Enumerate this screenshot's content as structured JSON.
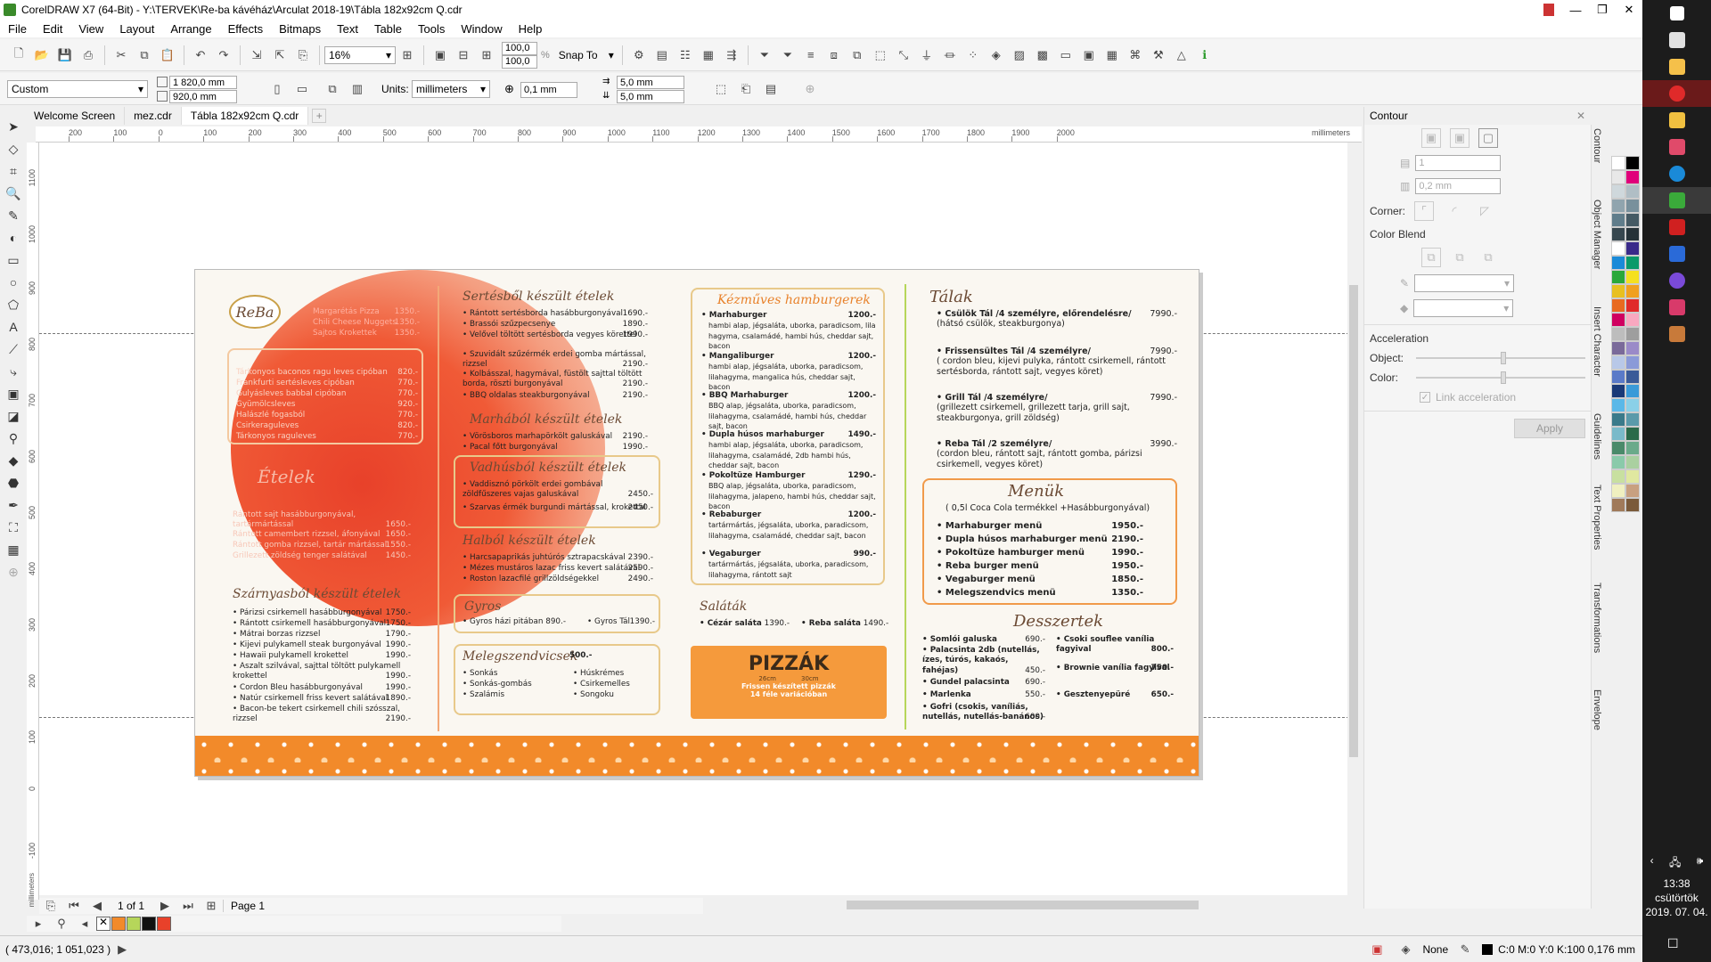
{
  "window": {
    "title": "CorelDRAW X7 (64-Bit) - Y:\\TERVEK\\Re-ba kávéház\\Arculat 2018-19\\Tábla 182x92cm Q.cdr"
  },
  "menu": [
    "File",
    "Edit",
    "View",
    "Layout",
    "Arrange",
    "Effects",
    "Bitmaps",
    "Text",
    "Table",
    "Tools",
    "Window",
    "Help"
  ],
  "toolbar": {
    "zoom": "16%",
    "snap_to": "Snap To",
    "scale_x": "100,0",
    "scale_y": "100,0",
    "pct": "%"
  },
  "propbar": {
    "preset": "Custom",
    "width": "1 820,0 mm",
    "height": "920,0 mm",
    "units_label": "Units:",
    "units": "millimeters",
    "nudge": "0,1 mm",
    "dup_x": "5,0 mm",
    "dup_y": "5,0 mm"
  },
  "tabs": [
    "Welcome Screen",
    "mez.cdr",
    "Tábla 182x92cm Q.cdr"
  ],
  "ruler": {
    "unit": "millimeters",
    "h_ticks": [
      "200",
      "100",
      "0",
      "100",
      "200",
      "300",
      "400",
      "500",
      "600",
      "700",
      "800",
      "900",
      "1000",
      "1100",
      "1200",
      "1300",
      "1400",
      "1500",
      "1600",
      "1700",
      "1800",
      "1900",
      "2000"
    ],
    "v_ticks": [
      "1100",
      "1000",
      "900",
      "800",
      "700",
      "600",
      "500",
      "400",
      "300",
      "200",
      "100",
      "0",
      "-100"
    ],
    "v_unit": "millimeters"
  },
  "pagenav": {
    "page_of": "1 of 1",
    "page_tab": "Page 1"
  },
  "status": {
    "coords": "( 473,016; 1 051,023 )",
    "fill": "None",
    "outline": "C:0 M:0 Y:0 K:100  0,176 mm"
  },
  "docker": {
    "title": "Contour",
    "steps": "1",
    "offset": "0,2 mm",
    "corner_label": "Corner:",
    "color_blend": "Color Blend",
    "acceleration": "Acceleration",
    "object_label": "Object:",
    "color_label": "Color:",
    "link_accel": "Link acceleration",
    "apply": "Apply"
  },
  "docker_tabs": [
    "Contour",
    "Object Manager",
    "Insert Character",
    "Guidelines",
    "Text Properties",
    "Transformations",
    "Envelope"
  ],
  "taskbar": {
    "time": "13:38",
    "day": "csütörtök",
    "date": "2019. 07. 04."
  },
  "colors": {
    "accent": "#e8412a",
    "orange": "#f28a2a",
    "gold": "#e8c98a"
  },
  "menu_doc": {
    "logo": "ReBa",
    "col1_top": [
      {
        "t": "Margarétás Pizza",
        "p": "1350.-"
      },
      {
        "t": "Chili Cheese Nuggets",
        "p": "1350.-"
      },
      {
        "t": "Sajtos Krokettek",
        "p": "1350.-"
      }
    ],
    "col1_box": [
      {
        "t": "Tárkonyos baconos ragu leves cipóban",
        "p": "820.-"
      },
      {
        "t": "Frankfurti sertésleves cipóban",
        "p": "770.-"
      },
      {
        "t": "Gulyásleves babbal cipóban",
        "p": "770.-"
      },
      {
        "t": "Gyümölcsleves",
        "p": "920.-"
      },
      {
        "t": "Halászlé fogasból",
        "p": "770.-"
      },
      {
        "t": "Csirkeraguleves",
        "p": "820.-"
      },
      {
        "t": "Tárkonyos raguleves",
        "p": "770.-"
      }
    ],
    "col1_mid_title": "Ételek",
    "col1_mid": [
      {
        "t": "Rántott sajt hasábburgonyával, tartármártással",
        "p": "1650.-"
      },
      {
        "t": "Rántott camembert rizzsel, áfonyával",
        "p": "1650.-"
      },
      {
        "t": "Rántott gomba rizzsel, tartár mártással",
        "p": "1550.-"
      },
      {
        "t": "Grillezett zöldség tenger salátával",
        "p": "1450.-"
      }
    ],
    "col1_bot_title": "Szárnyasból készült ételek",
    "col1_bot": [
      {
        "t": "Párizsi csirkemell hasábburgonyával",
        "p": "1750.-"
      },
      {
        "t": "Rántott csirkemell hasábburgonyával",
        "p": "1750.-"
      },
      {
        "t": "Mátrai borzas rizzsel",
        "p": "1790.-"
      },
      {
        "t": "Kijevi pulykamell steak burgonyával",
        "p": "1990.-"
      },
      {
        "t": "Hawaii pulykamell krokettel",
        "p": "1990.-"
      },
      {
        "t": "Aszalt szilvával, sajttal töltött pulykamell krokettel",
        "p": "1990.-"
      },
      {
        "t": "Cordon Bleu hasábburgonyával",
        "p": "1990.-"
      },
      {
        "t": "Natúr csirkemell friss kevert salátával",
        "p": "1890.-"
      },
      {
        "t": "Bacon-be tekert csirkemell chili szósszal, rizzsel",
        "p": "2190.-"
      }
    ],
    "col2_title": "Sertésből készült ételek",
    "col2": [
      {
        "t": "Rántott sertésborda hasábburgonyával",
        "p": "1690.-"
      },
      {
        "t": "Brassói szűzpecsenye",
        "p": "1890.-"
      },
      {
        "t": "Velővel töltött sertésborda vegyes körettel",
        "p": "1990.-"
      },
      {
        "t": "Szuvidált szűzérmék erdei gomba mártással, rizzsel",
        "p": "2190.-"
      },
      {
        "t": "Kolbásszal, hagymával, füstölt sajttal töltött borda, röszti burgonyával",
        "p": "2190.-"
      },
      {
        "t": "BBQ oldalas steakburgonyával",
        "p": "2190.-"
      }
    ],
    "col2b_title": "Marhából készült ételek",
    "col2b": [
      {
        "t": "Vörösboros marhapörkölt galuskával",
        "p": "2190.-"
      },
      {
        "t": "Pacal főtt burgonyával",
        "p": "1990.-"
      }
    ],
    "col2c_title": "Vadhúsból készült ételek",
    "col2c": [
      {
        "t": "Vaddisznó pörkölt erdei gombával zöldfűszeres vajas galuskával",
        "p": "2450.-"
      },
      {
        "t": "Szarvas érmék burgundi mártással, krokettal",
        "p": "2450.-"
      }
    ],
    "col2d_title": "Halból készült ételek",
    "col2d": [
      {
        "t": "Harcsapaprikás juhtúrós sztrapacskával",
        "p": "2390.-"
      },
      {
        "t": "Mézes mustáros lazac friss kevert salátával",
        "p": "2590.-"
      },
      {
        "t": "Roston lazacfilé grillzöldségekkel",
        "p": "2490.-"
      }
    ],
    "gyros_title": "Gyros",
    "gyros": [
      {
        "t": "Gyros házi pitában",
        "p": "890.-"
      },
      {
        "t": "Gyros Tál",
        "p": "1390.-"
      }
    ],
    "meleg_title": "Melegszendvicsek",
    "meleg_price": "500.-",
    "meleg_left": [
      "Sonkás",
      "Sonkás-gombás",
      "Szalámis"
    ],
    "meleg_right": [
      "Húskrémes",
      "Csirkemelles",
      "Songoku"
    ],
    "burg_title": "Kézműves hamburgerek",
    "burgers": [
      {
        "t": "Marhaburger",
        "p": "1200.-",
        "d": "hambi alap, jégsaláta, uborka, paradicsom, lila hagyma, csalamádé, hambi hús, cheddar sajt, bacon"
      },
      {
        "t": "Mangaliburger",
        "p": "1200.-",
        "d": "hambi alap, jégsaláta, uborka, paradicsom, lilahagyma, mangalica hús, cheddar sajt, bacon"
      },
      {
        "t": "BBQ Marhaburger",
        "p": "1200.-",
        "d": "BBQ alap, jégsaláta, uborka, paradicsom, lilahagyma, csalamádé, hambi hús, cheddar sajt, bacon"
      },
      {
        "t": "Dupla húsos marhaburger",
        "p": "1490.-",
        "d": "hambi alap, jégsaláta, uborka, paradicsom, lilahagyma, csalamádé, 2db hambi hús, cheddar sajt, bacon"
      },
      {
        "t": "Pokoltüze Hamburger",
        "p": "1290.-",
        "d": "BBQ alap, jégsaláta, uborka, paradicsom, lilahagyma, jalapeno, hambi hús, cheddar sajt, bacon"
      },
      {
        "t": "Rebaburger",
        "p": "1200.-",
        "d": "tartármártás, jégsaláta, uborka, paradicsom, lilahagyma, csalamádé, cheddar sajt, bacon"
      },
      {
        "t": "Vegaburger",
        "p": "990.-",
        "d": "tartármártás, jégsaláta, uborka, paradicsom, lilahagyma, rántott sajt"
      }
    ],
    "salad_title": "Saláták",
    "salads": [
      {
        "t": "Cézár saláta",
        "p": "1390.-"
      },
      {
        "t": "Reba saláta",
        "p": "1490.-"
      }
    ],
    "pizza_title": "PIZZÁK",
    "pizza_sizes": [
      "26cm",
      "30cm"
    ],
    "pizza_sub1": "Frissen készített pizzák",
    "pizza_sub2": "14 féle variációban",
    "talak_title": "Tálak",
    "talak": [
      {
        "t": "Csülök Tál /4 személyre, előrendelésre/",
        "p": "7990.-",
        "d": "(hátsó csülök, steakburgonya)"
      },
      {
        "t": "Frissensültes Tál /4 személyre/",
        "p": "7990.-",
        "d": "( cordon bleu, kijevi pulyka, rántott csirkemell, rántott sertésborda, rántott sajt, vegyes köret)"
      },
      {
        "t": "Grill Tál /4 személyre/",
        "p": "7990.-",
        "d": "(grillezett csirkemell, grillezett tarja, grill sajt, steakburgonya, grill zöldség)"
      },
      {
        "t": "Reba Tál /2 személyre/",
        "p": "3990.-",
        "d": "(cordon bleu, rántott sajt, rántott gomba, párizsi csirkemell, vegyes köret)"
      }
    ],
    "menuk_title": "Menük",
    "menuk_sub": "( 0,5l Coca Cola termékkel +Hasábburgonyával)",
    "menuk": [
      {
        "t": "Marhaburger menü",
        "p": "1950.-"
      },
      {
        "t": "Dupla húsos marhaburger menü",
        "p": "2190.-"
      },
      {
        "t": "Pokoltüze hamburger menü",
        "p": "1990.-"
      },
      {
        "t": "Reba burger menü",
        "p": "1950.-"
      },
      {
        "t": "Vegaburger menü",
        "p": "1850.-"
      },
      {
        "t": "Melegszendvics menü",
        "p": "1350.-"
      }
    ],
    "dessert_title": "Desszertek",
    "desserts_left": [
      {
        "t": "Somlói galuska",
        "p": "690.-"
      },
      {
        "t": "Palacsinta 2db (nutellás, ízes, túrós, kakaós, fahéjas)",
        "p": "450.-"
      },
      {
        "t": "Gundel palacsinta",
        "p": "690.-"
      },
      {
        "t": "Marlenka",
        "p": "550.-"
      },
      {
        "t": "Gofri (csokis, vaníliás, nutellás, nutellás-banános)",
        "p": "600.-"
      }
    ],
    "desserts_right": [
      {
        "t": "Csoki souflee vanília fagyival",
        "p": "800.-"
      },
      {
        "t": "Brownie vanília fagyival",
        "p": "750.-"
      },
      {
        "t": "Gesztenyepüré",
        "p": "650.-"
      }
    ]
  }
}
